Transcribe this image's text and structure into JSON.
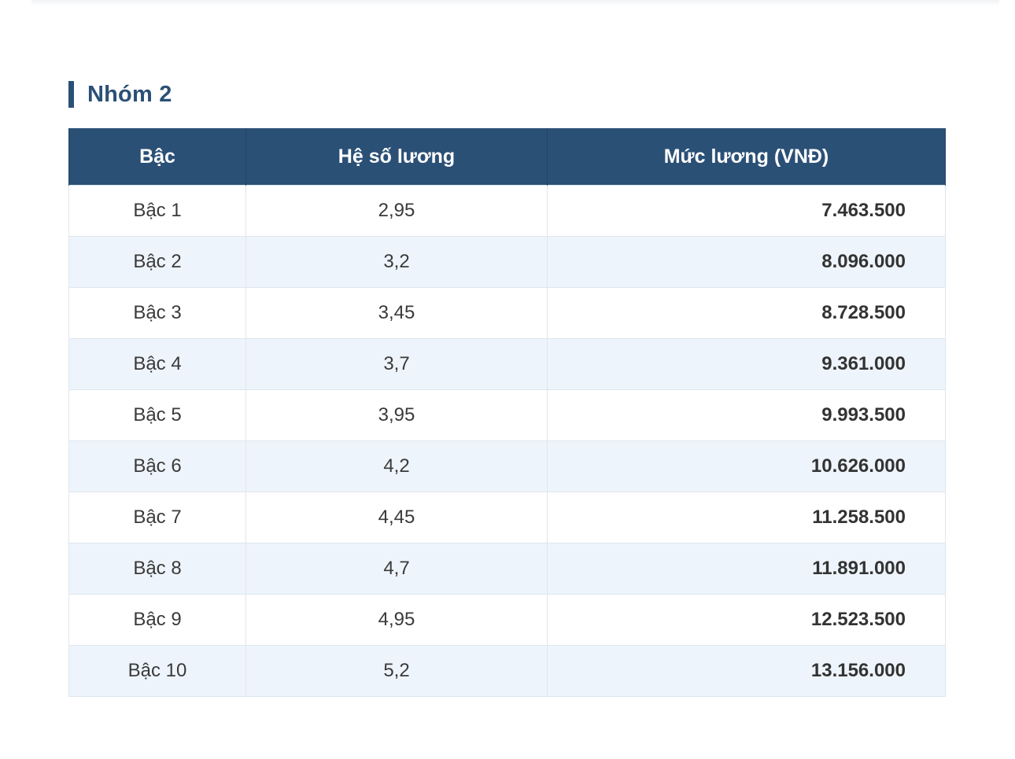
{
  "section": {
    "title": "Nhóm 2"
  },
  "table": {
    "headers": [
      "Bậc",
      "Hệ số lương",
      "Mức lương (VNĐ)"
    ],
    "rows": [
      {
        "level": "Bậc 1",
        "coefficient": "2,95",
        "salary": "7.463.500"
      },
      {
        "level": "Bậc 2",
        "coefficient": "3,2",
        "salary": "8.096.000"
      },
      {
        "level": "Bậc 3",
        "coefficient": "3,45",
        "salary": "8.728.500"
      },
      {
        "level": "Bậc 4",
        "coefficient": "3,7",
        "salary": "9.361.000"
      },
      {
        "level": "Bậc 5",
        "coefficient": "3,95",
        "salary": "9.993.500"
      },
      {
        "level": "Bậc 6",
        "coefficient": "4,2",
        "salary": "10.626.000"
      },
      {
        "level": "Bậc 7",
        "coefficient": "4,45",
        "salary": "11.258.500"
      },
      {
        "level": "Bậc 8",
        "coefficient": "4,7",
        "salary": "11.891.000"
      },
      {
        "level": "Bậc 9",
        "coefficient": "4,95",
        "salary": "12.523.500"
      },
      {
        "level": "Bậc 10",
        "coefficient": "5,2",
        "salary": "13.156.000"
      }
    ]
  },
  "colors": {
    "accent": "#2b5076",
    "row_alt": "#eef4fb",
    "border": "#dfe6ee"
  }
}
